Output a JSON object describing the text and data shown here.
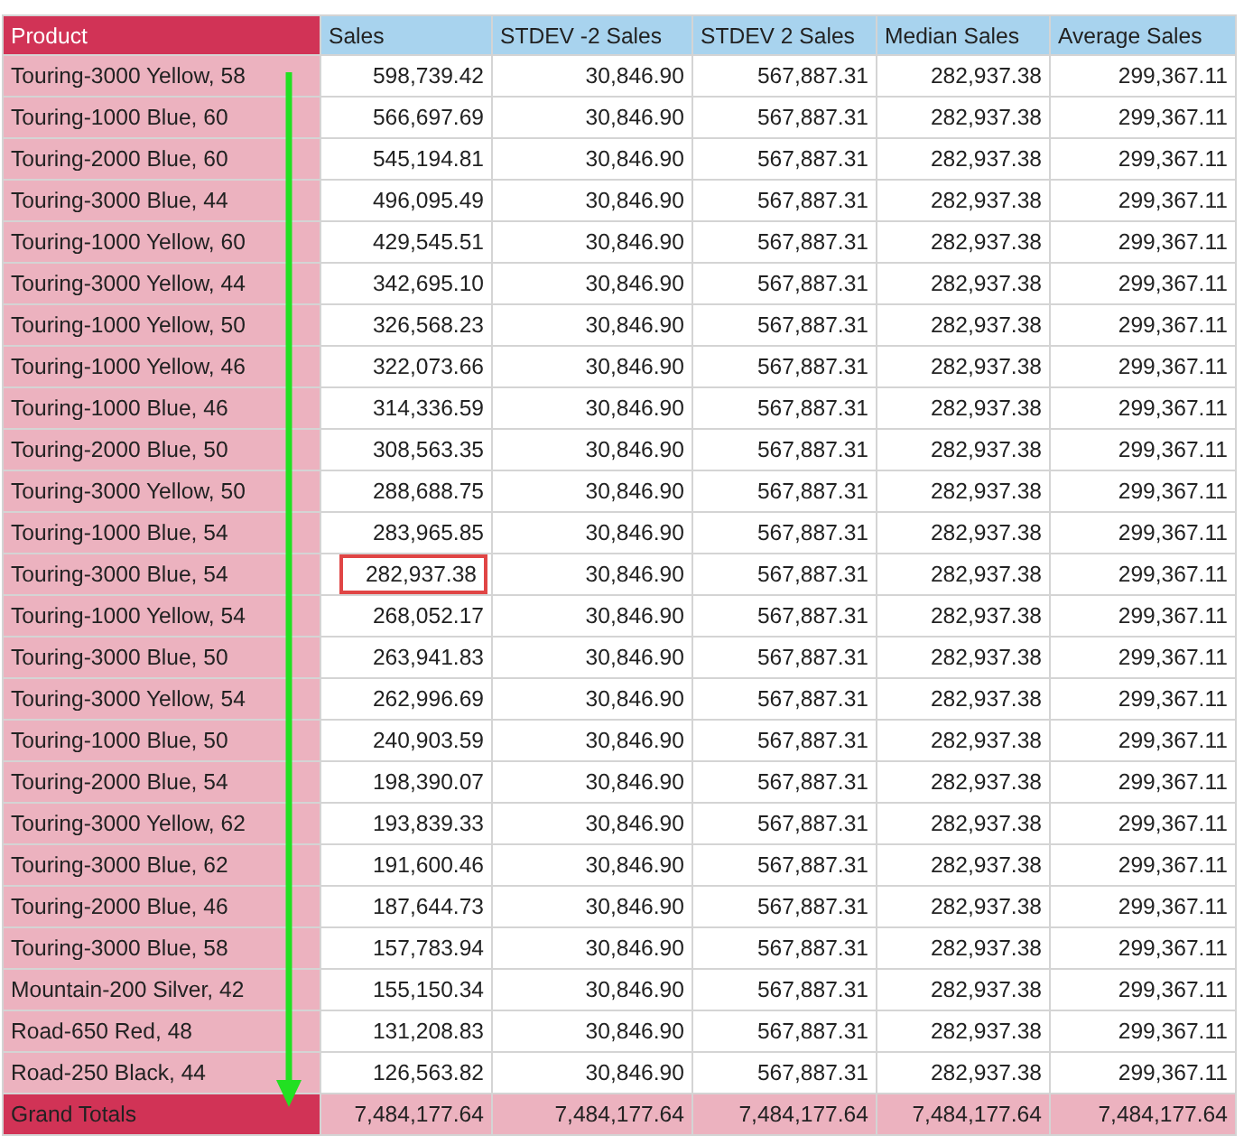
{
  "table": {
    "columns": [
      "Product",
      "Sales",
      "STDEV -2 Sales",
      "STDEV 2 Sales",
      "Median Sales",
      "Average Sales"
    ],
    "rows": [
      {
        "cells": [
          "Touring-3000 Yellow, 58",
          "598,739.42",
          "30,846.90",
          "567,887.31",
          "282,937.38",
          "299,367.11"
        ],
        "highlighted": false
      },
      {
        "cells": [
          "Touring-1000 Blue, 60",
          "566,697.69",
          "30,846.90",
          "567,887.31",
          "282,937.38",
          "299,367.11"
        ],
        "highlighted": false
      },
      {
        "cells": [
          "Touring-2000 Blue, 60",
          "545,194.81",
          "30,846.90",
          "567,887.31",
          "282,937.38",
          "299,367.11"
        ],
        "highlighted": false
      },
      {
        "cells": [
          "Touring-3000 Blue, 44",
          "496,095.49",
          "30,846.90",
          "567,887.31",
          "282,937.38",
          "299,367.11"
        ],
        "highlighted": false
      },
      {
        "cells": [
          "Touring-1000 Yellow, 60",
          "429,545.51",
          "30,846.90",
          "567,887.31",
          "282,937.38",
          "299,367.11"
        ],
        "highlighted": false
      },
      {
        "cells": [
          "Touring-3000 Yellow, 44",
          "342,695.10",
          "30,846.90",
          "567,887.31",
          "282,937.38",
          "299,367.11"
        ],
        "highlighted": false
      },
      {
        "cells": [
          "Touring-1000 Yellow, 50",
          "326,568.23",
          "30,846.90",
          "567,887.31",
          "282,937.38",
          "299,367.11"
        ],
        "highlighted": false
      },
      {
        "cells": [
          "Touring-1000 Yellow, 46",
          "322,073.66",
          "30,846.90",
          "567,887.31",
          "282,937.38",
          "299,367.11"
        ],
        "highlighted": false
      },
      {
        "cells": [
          "Touring-1000 Blue, 46",
          "314,336.59",
          "30,846.90",
          "567,887.31",
          "282,937.38",
          "299,367.11"
        ],
        "highlighted": false
      },
      {
        "cells": [
          "Touring-2000 Blue, 50",
          "308,563.35",
          "30,846.90",
          "567,887.31",
          "282,937.38",
          "299,367.11"
        ],
        "highlighted": false
      },
      {
        "cells": [
          "Touring-3000 Yellow, 50",
          "288,688.75",
          "30,846.90",
          "567,887.31",
          "282,937.38",
          "299,367.11"
        ],
        "highlighted": false
      },
      {
        "cells": [
          "Touring-1000 Blue, 54",
          "283,965.85",
          "30,846.90",
          "567,887.31",
          "282,937.38",
          "299,367.11"
        ],
        "highlighted": false
      },
      {
        "cells": [
          "Touring-3000 Blue, 54",
          "282,937.38",
          "30,846.90",
          "567,887.31",
          "282,937.38",
          "299,367.11"
        ],
        "highlighted": true
      },
      {
        "cells": [
          "Touring-1000 Yellow, 54",
          "268,052.17",
          "30,846.90",
          "567,887.31",
          "282,937.38",
          "299,367.11"
        ],
        "highlighted": false
      },
      {
        "cells": [
          "Touring-3000 Blue, 50",
          "263,941.83",
          "30,846.90",
          "567,887.31",
          "282,937.38",
          "299,367.11"
        ],
        "highlighted": false
      },
      {
        "cells": [
          "Touring-3000 Yellow, 54",
          "262,996.69",
          "30,846.90",
          "567,887.31",
          "282,937.38",
          "299,367.11"
        ],
        "highlighted": false
      },
      {
        "cells": [
          "Touring-1000 Blue, 50",
          "240,903.59",
          "30,846.90",
          "567,887.31",
          "282,937.38",
          "299,367.11"
        ],
        "highlighted": false
      },
      {
        "cells": [
          "Touring-2000 Blue, 54",
          "198,390.07",
          "30,846.90",
          "567,887.31",
          "282,937.38",
          "299,367.11"
        ],
        "highlighted": false
      },
      {
        "cells": [
          "Touring-3000 Yellow, 62",
          "193,839.33",
          "30,846.90",
          "567,887.31",
          "282,937.38",
          "299,367.11"
        ],
        "highlighted": false
      },
      {
        "cells": [
          "Touring-3000 Blue, 62",
          "191,600.46",
          "30,846.90",
          "567,887.31",
          "282,937.38",
          "299,367.11"
        ],
        "highlighted": false
      },
      {
        "cells": [
          "Touring-2000 Blue, 46",
          "187,644.73",
          "30,846.90",
          "567,887.31",
          "282,937.38",
          "299,367.11"
        ],
        "highlighted": false
      },
      {
        "cells": [
          "Touring-3000 Blue, 58",
          "157,783.94",
          "30,846.90",
          "567,887.31",
          "282,937.38",
          "299,367.11"
        ],
        "highlighted": false
      },
      {
        "cells": [
          "Mountain-200 Silver, 42",
          "155,150.34",
          "30,846.90",
          "567,887.31",
          "282,937.38",
          "299,367.11"
        ],
        "highlighted": false
      },
      {
        "cells": [
          "Road-650 Red, 48",
          "131,208.83",
          "30,846.90",
          "567,887.31",
          "282,937.38",
          "299,367.11"
        ],
        "highlighted": false
      },
      {
        "cells": [
          "Road-250 Black, 44",
          "126,563.82",
          "30,846.90",
          "567,887.31",
          "282,937.38",
          "299,367.11"
        ],
        "highlighted": false
      }
    ],
    "totals": [
      "Grand Totals",
      "7,484,177.64",
      "7,484,177.64",
      "7,484,177.64",
      "7,484,177.64",
      "7,484,177.64"
    ]
  }
}
